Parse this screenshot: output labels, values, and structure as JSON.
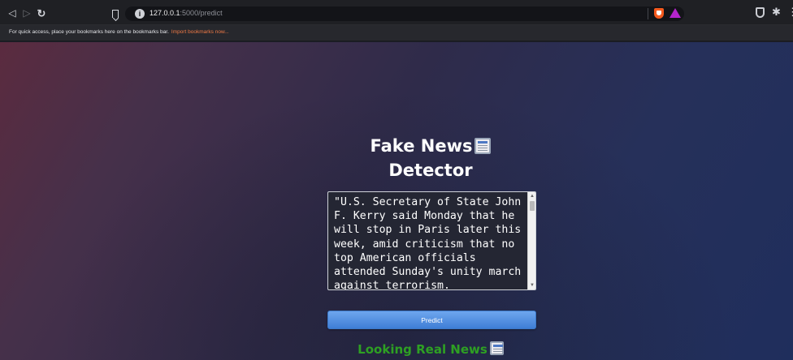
{
  "browser": {
    "url_host": "127.0.0.1",
    "url_path": ":5000/predict",
    "bookmarks_message": "For quick access, place your bookmarks here on the bookmarks bar.",
    "bookmarks_link": "Import bookmarks now..."
  },
  "icons": {
    "back": "back-arrow-icon",
    "forward": "forward-arrow-icon",
    "reload": "reload-icon",
    "bookmark": "bookmark-icon",
    "site_info": "info-icon",
    "shields": "brave-shields-icon",
    "rewards": "brave-rewards-icon",
    "vpn": "vpn-shield-icon",
    "extensions": "puzzle-icon",
    "menu": "menu-icon",
    "newspaper": "newspaper-icon"
  },
  "page": {
    "title_line1": "Fake News",
    "title_line2": "Detector",
    "article_text": "\"U.S. Secretary of State John F. Kerry said Monday that he will stop in Paris later this week, amid criticism that no top American officials attended Sunday's unity march against terrorism.",
    "predict_label": "Predict",
    "result_text": "Looking Real News"
  },
  "colors": {
    "result": "#2ea023",
    "button": "#5a95e4",
    "brave_accent": "#f55a1e"
  }
}
